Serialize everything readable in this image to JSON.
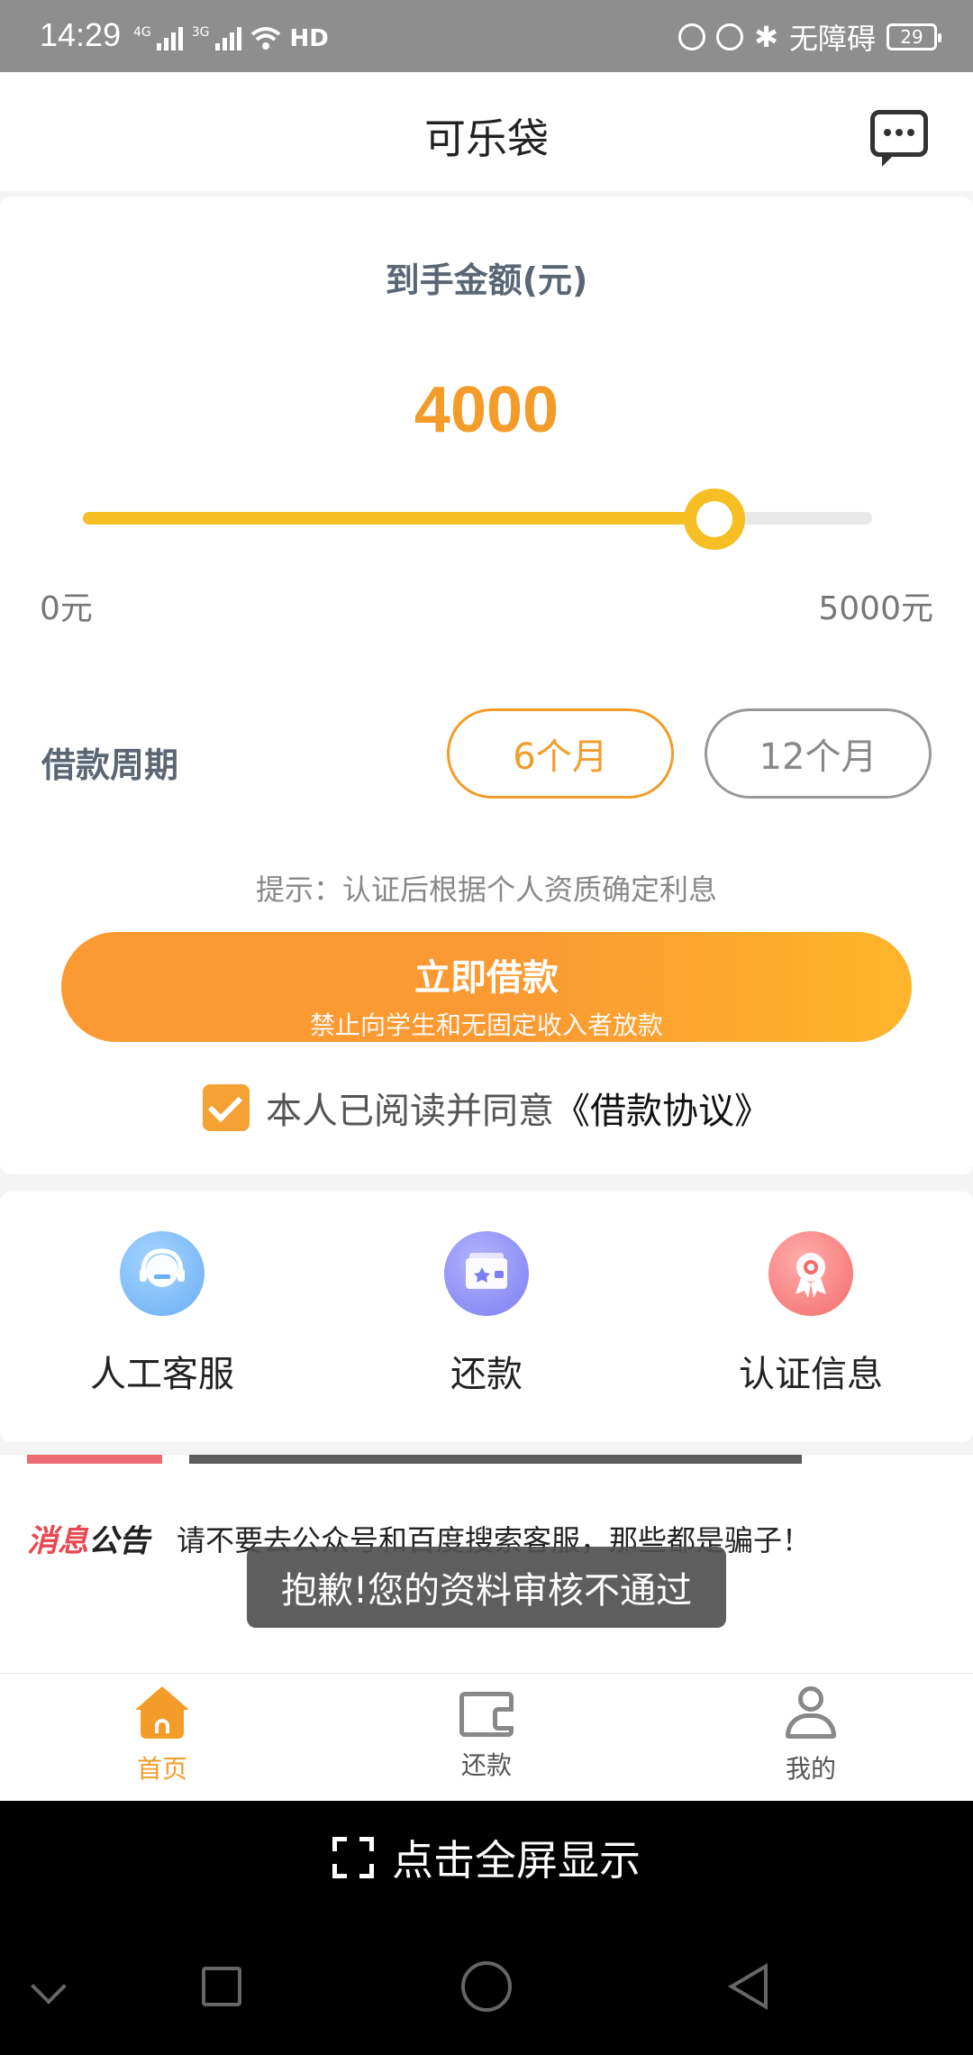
{
  "status_bar": {
    "time": "14:29",
    "network_1": "4G",
    "network_2": "3G",
    "hd_label": "HD",
    "accessibility": "无障碍",
    "battery": "29"
  },
  "header": {
    "title": "可乐袋"
  },
  "loan": {
    "amount_label": "到手金额(元)",
    "amount_value": "4000",
    "slider": {
      "min": 0,
      "max": 5000,
      "value": 4000
    },
    "min_label": "0元",
    "max_label": "5000元",
    "period_label": "借款周期",
    "periods": [
      {
        "label": "6个月",
        "selected": true
      },
      {
        "label": "12个月",
        "selected": false
      }
    ],
    "hint": "提示：认证后根据个人资质确定利息",
    "cta_main": "立即借款",
    "cta_sub": "禁止向学生和无固定收入者放款",
    "agree_text": "本人已阅读并同意",
    "agree_link": "《借款协议》",
    "agreed": true
  },
  "quick_actions": [
    {
      "label": "人工客服",
      "icon": "customer-service-icon"
    },
    {
      "label": "还款",
      "icon": "wallet-card-icon"
    },
    {
      "label": "认证信息",
      "icon": "certificate-badge-icon"
    }
  ],
  "notice": {
    "tag_red": "消息",
    "tag_dark": "公告",
    "text": "请不要去公众号和百度搜索客服，那些都是骗子！"
  },
  "toast": "抱歉!您的资料审核不通过",
  "bottom_nav": [
    {
      "label": "首页",
      "active": true,
      "icon": "home-icon"
    },
    {
      "label": "还款",
      "active": false,
      "icon": "wallet-icon"
    },
    {
      "label": "我的",
      "active": false,
      "icon": "user-icon"
    }
  ],
  "fullscreen_label": "点击全屏显示",
  "colors": {
    "accent": "#f39c2a",
    "slider": "#f6bf24",
    "notice_red": "#e8484f"
  }
}
